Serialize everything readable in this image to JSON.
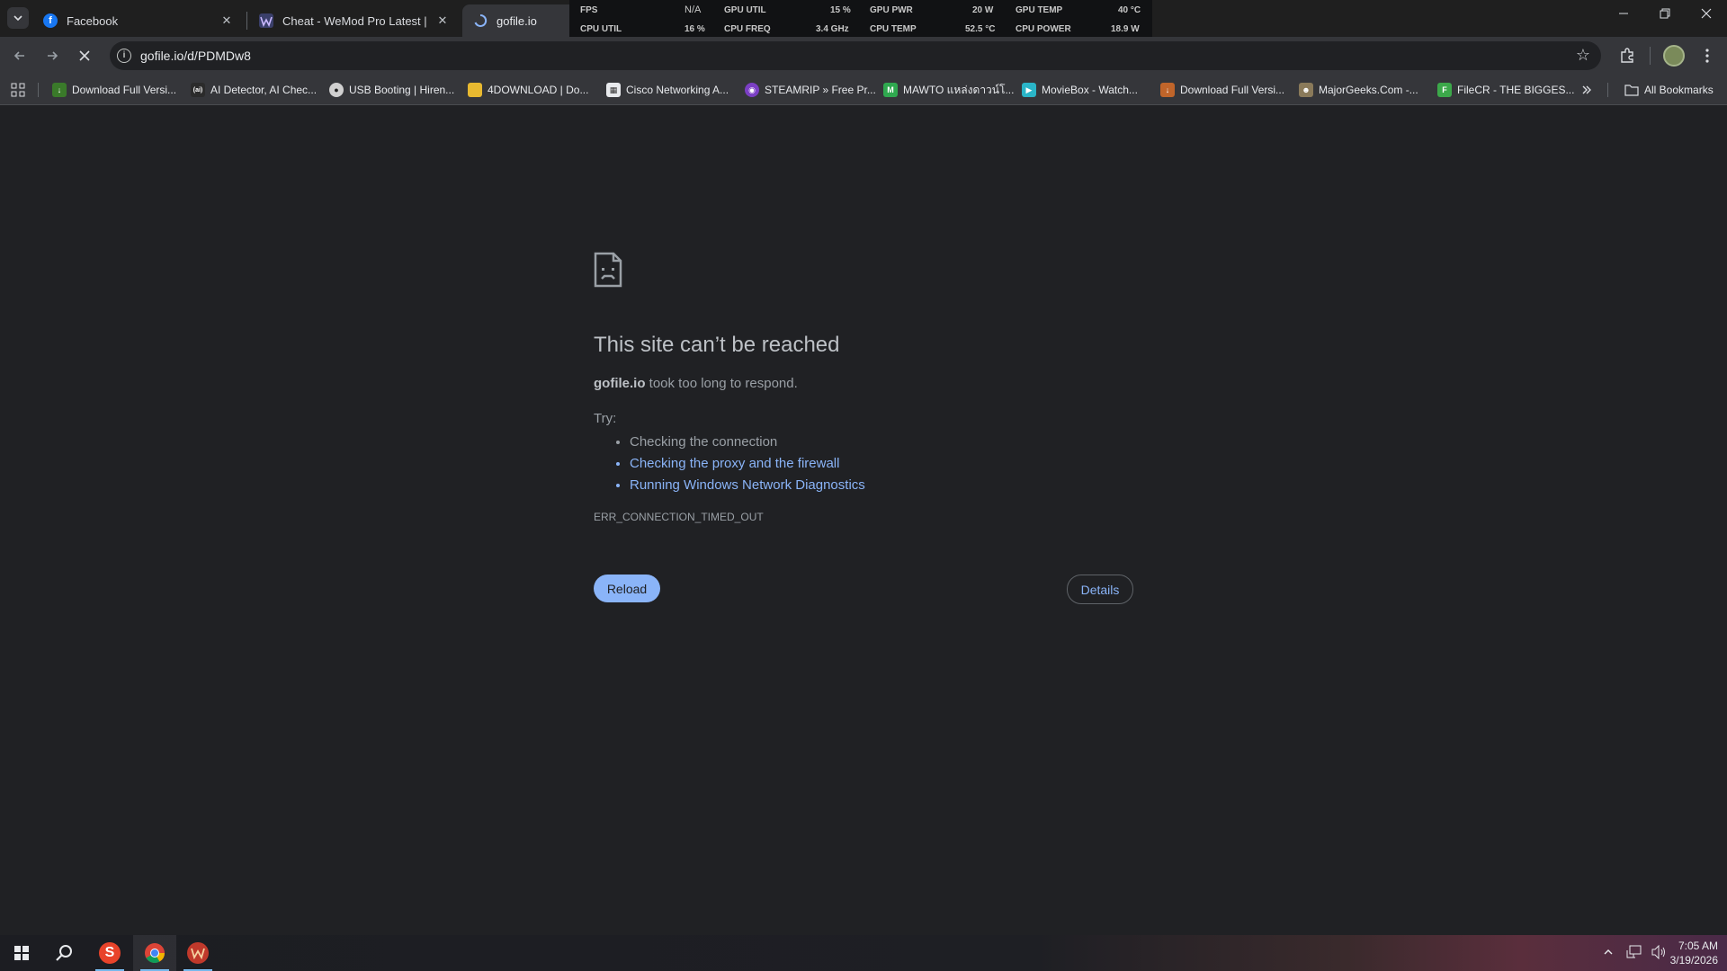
{
  "tabs": [
    {
      "title": "Facebook",
      "favicon": "facebook-icon",
      "active": false
    },
    {
      "title": "Cheat - WeMod Pro Latest | Pin",
      "favicon": "wemod-icon",
      "active": false
    },
    {
      "title": "gofile.io",
      "favicon": "loading-spinner-icon",
      "active": true
    }
  ],
  "perf": {
    "fps_label": "FPS",
    "fps_value": "N/A",
    "cpu_util_label": "CPU UTIL",
    "cpu_util_value": "16 %",
    "gpu_util_label": "GPU UTIL",
    "gpu_util_value": "15 %",
    "cpu_freq_label": "CPU FREQ",
    "cpu_freq_value": "3.4 GHz",
    "gpu_pwr_label": "GPU PWR",
    "gpu_pwr_value": "20 W",
    "cpu_temp_label": "CPU TEMP",
    "cpu_temp_value": "52.5 °C",
    "gpu_temp_label": "GPU TEMP",
    "gpu_temp_value": "40 °C",
    "cpu_power_label": "CPU POWER",
    "cpu_power_value": "18.9 W"
  },
  "toolbar": {
    "url": "gofile.io/d/PDMDw8"
  },
  "bookmarks": [
    {
      "label": "Download Full Versi...",
      "icon": "download-icon",
      "color": "#3a7a2a"
    },
    {
      "label": "AI Detector, AI Chec...",
      "icon": "ai-detector-icon",
      "color": "#2b2b2b"
    },
    {
      "label": "USB Booting | Hiren...",
      "icon": "usb-icon",
      "color": "#d0d0d0"
    },
    {
      "label": "4DOWNLOAD | Do...",
      "icon": "folder-icon",
      "color": "#e8b930"
    },
    {
      "label": "Cisco Networking A...",
      "icon": "cisco-icon",
      "color": "#e8eaed"
    },
    {
      "label": "STEAMRIP » Free Pr...",
      "icon": "steamrip-icon",
      "color": "#7b3fc4"
    },
    {
      "label": "MAWTO แหล่งดาวน์โ...",
      "icon": "mawto-icon",
      "color": "#2fa84f"
    },
    {
      "label": "MovieBox - Watch...",
      "icon": "moviebox-icon",
      "color": "#2ab5c8"
    },
    {
      "label": "Download Full Versi...",
      "icon": "download-icon",
      "color": "#c0652a"
    },
    {
      "label": "MajorGeeks.Com -...",
      "icon": "majorgeeks-icon",
      "color": "#8a7a5a"
    },
    {
      "label": "FileCR - THE BIGGES...",
      "icon": "filecr-icon",
      "color": "#3ca84a"
    }
  ],
  "all_bookmarks_label": "All Bookmarks",
  "error": {
    "title": "This site can’t be reached",
    "host": "gofile.io",
    "desc": " took too long to respond.",
    "try_label": "Try:",
    "suggestions": [
      "Checking the connection",
      "Checking the proxy and the firewall",
      "Running Windows Network Diagnostics"
    ],
    "code": "ERR_CONNECTION_TIMED_OUT",
    "reload_label": "Reload",
    "details_label": "Details"
  },
  "taskbar": {
    "time": "7:05 AM",
    "date": "3/19/2026"
  }
}
